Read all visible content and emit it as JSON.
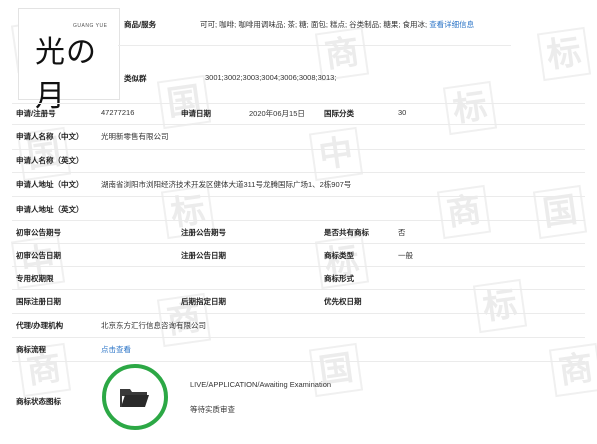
{
  "watermark_char_a": "中",
  "watermark_char_b": "国",
  "watermark_char_c": "商",
  "watermark_char_d": "标",
  "logo": {
    "text": "光の月",
    "small": "GUANG YUE"
  },
  "goods": {
    "label": "商品/服务",
    "value": "可可; 咖啡; 咖啡用调味品; 茶; 糖; 面包; 糕点; 谷类制品; 糖果; 食用冰;",
    "link": "查看详细信息"
  },
  "similar": {
    "label": "类似群",
    "value": "3001;3002;3003;3004;3006;3008;3013;"
  },
  "reg_no": {
    "label": "申请/注册号",
    "value": "47277216"
  },
  "app_date": {
    "label": "申请日期",
    "value": "2020年06月15日"
  },
  "intl_class": {
    "label": "国际分类",
    "value": "30"
  },
  "applicant_cn": {
    "label": "申请人名称（中文）",
    "value": "光明新零售有限公司"
  },
  "applicant_en": {
    "label": "申请人名称（英文）",
    "value": ""
  },
  "address_cn": {
    "label": "申请人地址（中文）",
    "value": "湖南省浏阳市浏阳经济技术开发区健体大道311号龙腾国际广场1、2栋907号"
  },
  "address_en": {
    "label": "申请人地址（英文）",
    "value": ""
  },
  "prelim_no": {
    "label": "初审公告期号",
    "value": ""
  },
  "reg_pub_no": {
    "label": "注册公告期号",
    "value": ""
  },
  "shared": {
    "label": "是否共有商标",
    "value": "否"
  },
  "prelim_date": {
    "label": "初审公告日期",
    "value": ""
  },
  "reg_pub_date": {
    "label": "注册公告日期",
    "value": ""
  },
  "tm_type": {
    "label": "商标类型",
    "value": "一般"
  },
  "exclusive": {
    "label": "专用权期限",
    "value": ""
  },
  "tm_form": {
    "label": "商标形式",
    "value": ""
  },
  "intl_reg_date": {
    "label": "国际注册日期",
    "value": ""
  },
  "later_date": {
    "label": "后期指定日期",
    "value": ""
  },
  "priority_date": {
    "label": "优先权日期",
    "value": ""
  },
  "agent": {
    "label": "代理/办理机构",
    "value": "北京东方汇行信息咨询有限公司"
  },
  "process": {
    "label": "商标流程",
    "link": "点击查看"
  },
  "status": {
    "label": "商标状态图标",
    "en": "LIVE/APPLICATION/Awaiting Examination",
    "cn": "等待实质审查"
  },
  "colors": {
    "accent": "#2b74c7",
    "status_green": "#2ca845"
  }
}
